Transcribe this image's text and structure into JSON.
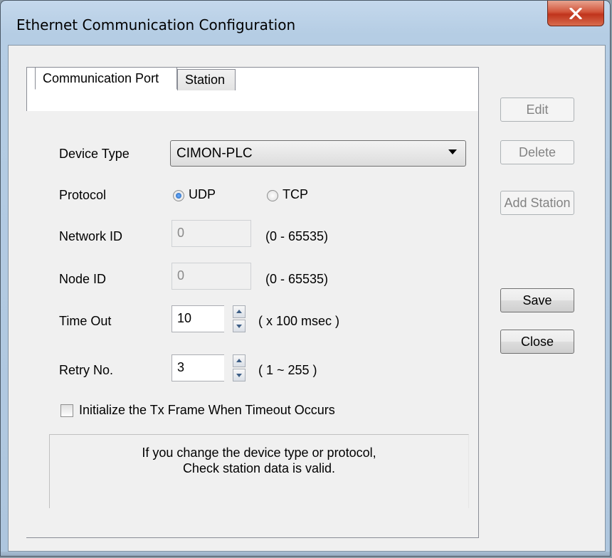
{
  "window": {
    "title": "Ethernet Communication Configuration"
  },
  "tabs": [
    {
      "label": "Communication Port",
      "active": true
    },
    {
      "label": "Station",
      "active": false
    }
  ],
  "form": {
    "device_type": {
      "label": "Device Type",
      "value": "CIMON-PLC"
    },
    "protocol": {
      "label": "Protocol",
      "options": [
        {
          "label": "UDP",
          "selected": true
        },
        {
          "label": "TCP",
          "selected": false
        }
      ]
    },
    "network_id": {
      "label": "Network ID",
      "value": "0",
      "range": "(0 - 65535)",
      "enabled": false
    },
    "node_id": {
      "label": "Node ID",
      "value": "0",
      "range": "(0 - 65535)",
      "enabled": false
    },
    "time_out": {
      "label": "Time Out",
      "value": "10",
      "unit": "( x 100 msec )"
    },
    "retry_no": {
      "label": "Retry No.",
      "value": "3",
      "range": "( 1 ~ 255 )"
    },
    "init_tx_frame": {
      "label": "Initialize the Tx Frame When Timeout  Occurs",
      "checked": false
    }
  },
  "notice": {
    "line1": "If you change the device type or protocol,",
    "line2": "Check station data is valid."
  },
  "side_buttons": {
    "edit": {
      "label": "Edit",
      "enabled": false
    },
    "delete": {
      "label": "Delete",
      "enabled": false
    },
    "add_station": {
      "label": "Add Station",
      "enabled": false
    },
    "save": {
      "label": "Save",
      "enabled": true
    },
    "close": {
      "label": "Close",
      "enabled": true
    }
  },
  "icons": {
    "close": "close-x-icon",
    "dropdown": "chevron-down-icon",
    "spin_up": "arrow-up-icon",
    "spin_down": "arrow-down-icon"
  },
  "colors": {
    "close_button": "#c0341c",
    "title_frame": "#b5cde4",
    "dialog_bg": "#f0f0f0"
  }
}
